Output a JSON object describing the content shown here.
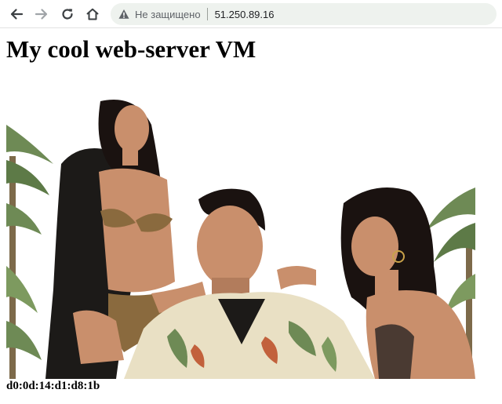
{
  "browser": {
    "back_icon": "arrow-left-icon",
    "forward_icon": "arrow-right-icon",
    "reload_icon": "reload-icon",
    "home_icon": "home-icon",
    "security_icon": "warning-triangle-icon",
    "security_label": "Не защищено",
    "url": "51.250.89.16"
  },
  "page": {
    "title": "My cool web-server VM",
    "image": {
      "subject": "photo-three-people-palm-trees",
      "colors": {
        "skin": "#c98f6c",
        "hair": "#1a1210",
        "shirt": "#e9e0c4",
        "leaves": "#6e8a55",
        "dark_robe": "#1c1a18",
        "leopard": "#8a6a3e"
      }
    },
    "mac_address": "d0:0d:14:d1:d8:1b"
  }
}
